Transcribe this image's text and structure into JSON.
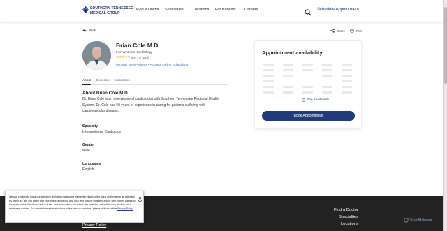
{
  "header": {
    "logo_line1": "SOUTHERN TENNESSEE",
    "logo_line2": "MEDICAL GROUP",
    "nav": [
      "Find a Doctor",
      "Specialties",
      "Locations",
      "For Patients",
      "Careers"
    ],
    "schedule_label": "Schedule Appointment"
  },
  "actions": {
    "back": "Back",
    "share": "Share",
    "print": "Print"
  },
  "doctor": {
    "name": "Brian Cole M.D.",
    "specialty": "Interventional Cardiology",
    "rating": "4.9",
    "rating_max": "/ 5 (119)",
    "accepts": "Accepts New Patients • Accepts Online Scheduling"
  },
  "tabs": [
    "About",
    "Expertise",
    "Locations"
  ],
  "about": {
    "title": "About Brian Cole M.D.",
    "text": "Dr. Brian Cole is an interventional cardiologist with Southern Tennessee Regional Health System. Dr. Cole has 50 years of experience in caring for patients suffering with cardiovascular disease.",
    "specialty_label": "Specialty",
    "specialty_value": "Interventional Cardiology",
    "gender_label": "Gender",
    "gender_value": "Male",
    "languages_label": "Languages",
    "languages_value": "English"
  },
  "availability": {
    "title": "Appointment availability",
    "see_label": "See Availability",
    "book_label": "Book Appointment"
  },
  "footer": {
    "links": [
      "Find a Doctor",
      "Specialties",
      "Locations"
    ],
    "privacy": "Privacy Policy"
  },
  "cookie": {
    "text": "We use cookies to make our site work, including measuring elements related to the site's performance as intended. By using our site you agree that information about you and your visit may be collected and/or sent to third parties for these purposes. We do not sell or share your information, nor do we use analytics, advertisement, or other non-necessary cookies. For more information about our online privacy practices, please visit our online",
    "link": "Privacy Policy."
  },
  "watermark": "ScanMalware",
  "colors": {
    "brand_navy": "#1f3b7a",
    "link_blue": "#1f3b8a",
    "star": "#f0a12a",
    "footer_bg": "#232323"
  }
}
